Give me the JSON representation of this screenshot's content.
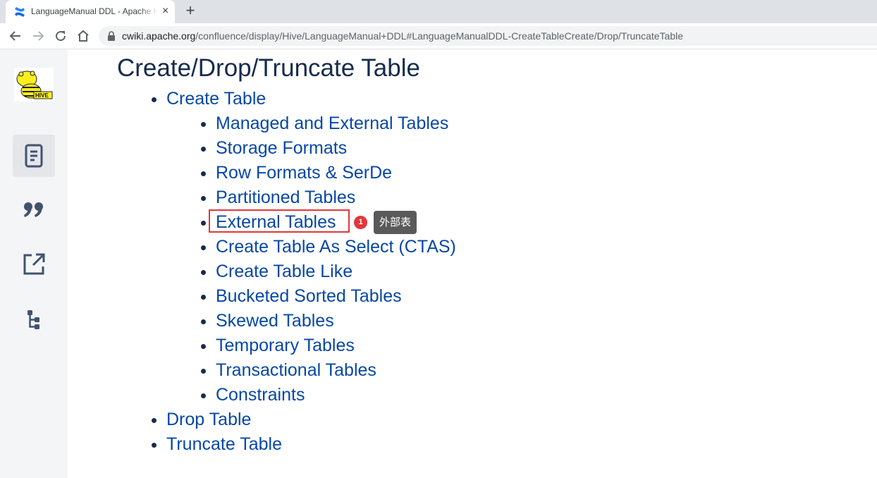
{
  "browser": {
    "tab_title": "LanguageManual DDL - Apache Hive",
    "tab_close": "×",
    "new_tab": "+",
    "url_host": "cwiki.apache.org",
    "url_path": "/confluence/display/Hive/LanguageManual+DDL#LanguageManualDDL-CreateTableCreate/Drop/TruncateTable"
  },
  "sidebar": {
    "logo": "HIVE",
    "items": [
      {
        "icon": "page-icon",
        "active": true
      },
      {
        "icon": "quote-icon",
        "active": false
      },
      {
        "icon": "external-link-icon",
        "active": false
      },
      {
        "icon": "page-tree-icon",
        "active": false
      }
    ]
  },
  "content": {
    "title": "Create/Drop/Truncate Table",
    "create_table": "Create Table",
    "create_table_children": [
      "Managed and External Tables",
      "Storage Formats",
      "Row Formats & SerDe",
      "Partitioned Tables",
      "External Tables",
      "Create Table As Select (CTAS)",
      "Create Table Like",
      "Bucketed Sorted Tables",
      "Skewed Tables",
      "Temporary Tables",
      "Transactional Tables",
      "Constraints"
    ],
    "drop_table": "Drop Table",
    "truncate_table": "Truncate Table"
  },
  "annotation": {
    "badge": "1",
    "tooltip": "外部表"
  },
  "colors": {
    "link": "#0747a6",
    "heading": "#172b4d",
    "highlight": "#e3363a"
  }
}
